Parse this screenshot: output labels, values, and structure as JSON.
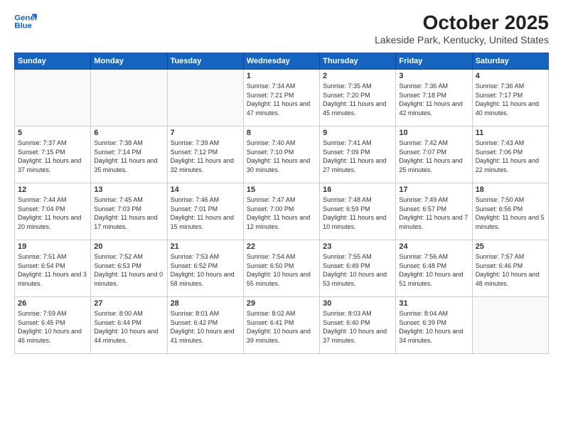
{
  "header": {
    "logo_line1": "General",
    "logo_line2": "Blue",
    "title": "October 2025",
    "subtitle": "Lakeside Park, Kentucky, United States"
  },
  "days_of_week": [
    "Sunday",
    "Monday",
    "Tuesday",
    "Wednesday",
    "Thursday",
    "Friday",
    "Saturday"
  ],
  "weeks": [
    [
      {
        "day": "",
        "info": ""
      },
      {
        "day": "",
        "info": ""
      },
      {
        "day": "",
        "info": ""
      },
      {
        "day": "1",
        "info": "Sunrise: 7:34 AM\nSunset: 7:21 PM\nDaylight: 11 hours\nand 47 minutes."
      },
      {
        "day": "2",
        "info": "Sunrise: 7:35 AM\nSunset: 7:20 PM\nDaylight: 11 hours\nand 45 minutes."
      },
      {
        "day": "3",
        "info": "Sunrise: 7:36 AM\nSunset: 7:18 PM\nDaylight: 11 hours\nand 42 minutes."
      },
      {
        "day": "4",
        "info": "Sunrise: 7:36 AM\nSunset: 7:17 PM\nDaylight: 11 hours\nand 40 minutes."
      }
    ],
    [
      {
        "day": "5",
        "info": "Sunrise: 7:37 AM\nSunset: 7:15 PM\nDaylight: 11 hours\nand 37 minutes."
      },
      {
        "day": "6",
        "info": "Sunrise: 7:38 AM\nSunset: 7:14 PM\nDaylight: 11 hours\nand 35 minutes."
      },
      {
        "day": "7",
        "info": "Sunrise: 7:39 AM\nSunset: 7:12 PM\nDaylight: 11 hours\nand 32 minutes."
      },
      {
        "day": "8",
        "info": "Sunrise: 7:40 AM\nSunset: 7:10 PM\nDaylight: 11 hours\nand 30 minutes."
      },
      {
        "day": "9",
        "info": "Sunrise: 7:41 AM\nSunset: 7:09 PM\nDaylight: 11 hours\nand 27 minutes."
      },
      {
        "day": "10",
        "info": "Sunrise: 7:42 AM\nSunset: 7:07 PM\nDaylight: 11 hours\nand 25 minutes."
      },
      {
        "day": "11",
        "info": "Sunrise: 7:43 AM\nSunset: 7:06 PM\nDaylight: 11 hours\nand 22 minutes."
      }
    ],
    [
      {
        "day": "12",
        "info": "Sunrise: 7:44 AM\nSunset: 7:04 PM\nDaylight: 11 hours\nand 20 minutes."
      },
      {
        "day": "13",
        "info": "Sunrise: 7:45 AM\nSunset: 7:03 PM\nDaylight: 11 hours\nand 17 minutes."
      },
      {
        "day": "14",
        "info": "Sunrise: 7:46 AM\nSunset: 7:01 PM\nDaylight: 11 hours\nand 15 minutes."
      },
      {
        "day": "15",
        "info": "Sunrise: 7:47 AM\nSunset: 7:00 PM\nDaylight: 11 hours\nand 12 minutes."
      },
      {
        "day": "16",
        "info": "Sunrise: 7:48 AM\nSunset: 6:59 PM\nDaylight: 11 hours\nand 10 minutes."
      },
      {
        "day": "17",
        "info": "Sunrise: 7:49 AM\nSunset: 6:57 PM\nDaylight: 11 hours\nand 7 minutes."
      },
      {
        "day": "18",
        "info": "Sunrise: 7:50 AM\nSunset: 6:56 PM\nDaylight: 11 hours\nand 5 minutes."
      }
    ],
    [
      {
        "day": "19",
        "info": "Sunrise: 7:51 AM\nSunset: 6:54 PM\nDaylight: 11 hours\nand 3 minutes."
      },
      {
        "day": "20",
        "info": "Sunrise: 7:52 AM\nSunset: 6:53 PM\nDaylight: 11 hours\nand 0 minutes."
      },
      {
        "day": "21",
        "info": "Sunrise: 7:53 AM\nSunset: 6:52 PM\nDaylight: 10 hours\nand 58 minutes."
      },
      {
        "day": "22",
        "info": "Sunrise: 7:54 AM\nSunset: 6:50 PM\nDaylight: 10 hours\nand 55 minutes."
      },
      {
        "day": "23",
        "info": "Sunrise: 7:55 AM\nSunset: 6:49 PM\nDaylight: 10 hours\nand 53 minutes."
      },
      {
        "day": "24",
        "info": "Sunrise: 7:56 AM\nSunset: 6:48 PM\nDaylight: 10 hours\nand 51 minutes."
      },
      {
        "day": "25",
        "info": "Sunrise: 7:57 AM\nSunset: 6:46 PM\nDaylight: 10 hours\nand 48 minutes."
      }
    ],
    [
      {
        "day": "26",
        "info": "Sunrise: 7:59 AM\nSunset: 6:45 PM\nDaylight: 10 hours\nand 46 minutes."
      },
      {
        "day": "27",
        "info": "Sunrise: 8:00 AM\nSunset: 6:44 PM\nDaylight: 10 hours\nand 44 minutes."
      },
      {
        "day": "28",
        "info": "Sunrise: 8:01 AM\nSunset: 6:42 PM\nDaylight: 10 hours\nand 41 minutes."
      },
      {
        "day": "29",
        "info": "Sunrise: 8:02 AM\nSunset: 6:41 PM\nDaylight: 10 hours\nand 39 minutes."
      },
      {
        "day": "30",
        "info": "Sunrise: 8:03 AM\nSunset: 6:40 PM\nDaylight: 10 hours\nand 37 minutes."
      },
      {
        "day": "31",
        "info": "Sunrise: 8:04 AM\nSunset: 6:39 PM\nDaylight: 10 hours\nand 34 minutes."
      },
      {
        "day": "",
        "info": ""
      }
    ]
  ]
}
